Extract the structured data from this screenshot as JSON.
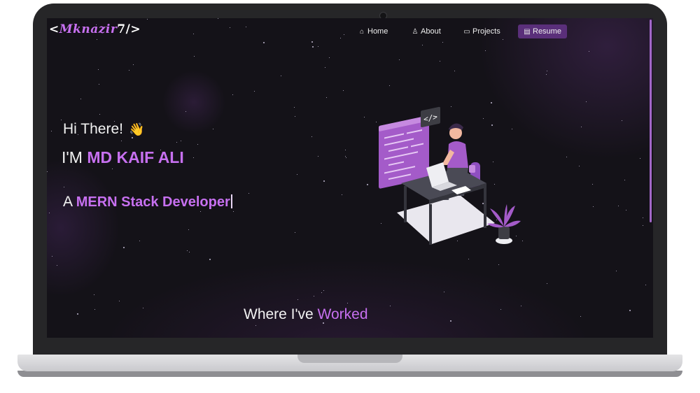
{
  "logo": {
    "prefix": "<",
    "script": "Mknazir",
    "suffix": "7/>"
  },
  "nav": {
    "items": [
      {
        "label": "Home",
        "icon": "home-icon"
      },
      {
        "label": "About",
        "icon": "user-icon"
      },
      {
        "label": "Projects",
        "icon": "projects-icon"
      },
      {
        "label": "Resume",
        "icon": "document-icon"
      }
    ]
  },
  "hero": {
    "greeting": "Hi There!",
    "wave_icon": "waving-hand-icon",
    "name_prefix": "I'M ",
    "name": "MD KAIF ALI",
    "role_prefix": "A ",
    "role": "MERN Stack Developer"
  },
  "section": {
    "title_prefix": "Where I've ",
    "title_highlight": "Worked"
  },
  "colors": {
    "accent": "#c770f0",
    "background": "#141218",
    "nav_resume_bg": "#5a2f7a"
  }
}
